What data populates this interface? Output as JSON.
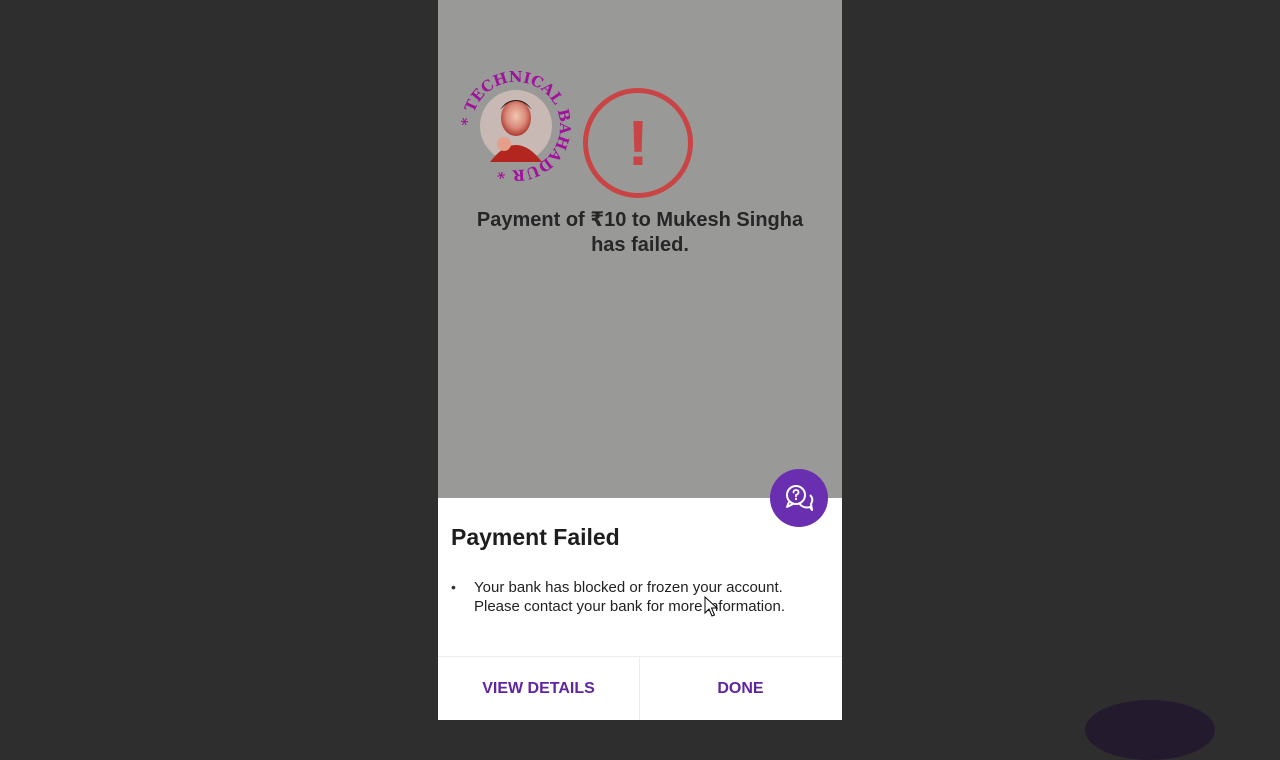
{
  "watermark": {
    "text": "* TECHNICAL BAHADUR *",
    "color": "#a0119c"
  },
  "status": {
    "icon": "exclamation-circle-icon",
    "glyph": "!",
    "color": "#c94545",
    "message": "Payment of ₹10 to Mukesh Singha has failed."
  },
  "help_button": {
    "icon": "chat-question-icon",
    "color": "#6a2fb0"
  },
  "sheet": {
    "title": "Payment Failed",
    "bullet": "•",
    "reasons": [
      "Your bank has blocked or frozen your account. Please contact your bank for more information."
    ]
  },
  "actions": {
    "view_details": "VIEW DETAILS",
    "done": "DONE",
    "color": "#5f259f"
  }
}
